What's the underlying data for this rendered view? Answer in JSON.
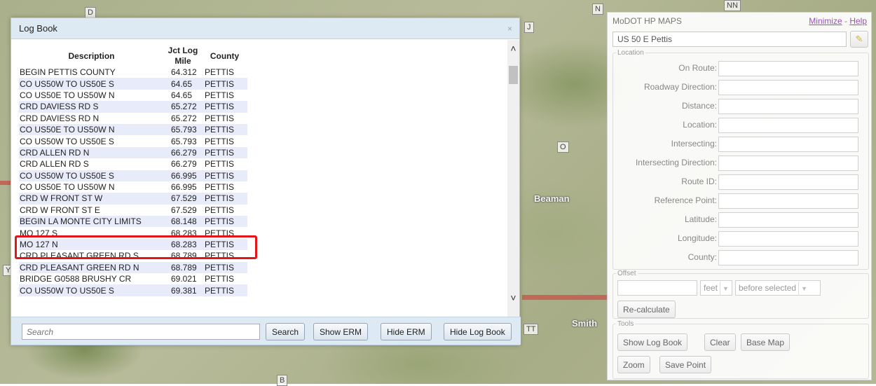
{
  "map": {
    "labels": {
      "d": "D",
      "n": "N",
      "nn": "NN",
      "j": "J",
      "o": "O",
      "b": "B",
      "tt": "TT",
      "y": "Y"
    },
    "towns": {
      "beaman": "Beaman",
      "smith": "Smith"
    }
  },
  "logbook": {
    "title": "Log Book",
    "close_icon": "close-icon",
    "columns": {
      "description": "Description",
      "log_mile": "Jct Log Mile",
      "county": "County"
    },
    "rows": [
      {
        "description": "BEGIN PETTIS COUNTY",
        "log_mile": "64.312",
        "county": "PETTIS"
      },
      {
        "description": "CO US50W TO US50E S",
        "log_mile": "64.65",
        "county": "PETTIS"
      },
      {
        "description": "CO US50E TO US50W N",
        "log_mile": "64.65",
        "county": "PETTIS"
      },
      {
        "description": "CRD DAVIESS RD S",
        "log_mile": "65.272",
        "county": "PETTIS"
      },
      {
        "description": "CRD DAVIESS RD N",
        "log_mile": "65.272",
        "county": "PETTIS"
      },
      {
        "description": "CO US50E TO US50W N",
        "log_mile": "65.793",
        "county": "PETTIS"
      },
      {
        "description": "CO US50W TO US50E S",
        "log_mile": "65.793",
        "county": "PETTIS"
      },
      {
        "description": "CRD ALLEN RD N",
        "log_mile": "66.279",
        "county": "PETTIS"
      },
      {
        "description": "CRD ALLEN RD S",
        "log_mile": "66.279",
        "county": "PETTIS"
      },
      {
        "description": "CO US50W TO US50E S",
        "log_mile": "66.995",
        "county": "PETTIS"
      },
      {
        "description": "CO US50E TO US50W N",
        "log_mile": "66.995",
        "county": "PETTIS"
      },
      {
        "description": "CRD W FRONT ST W",
        "log_mile": "67.529",
        "county": "PETTIS"
      },
      {
        "description": "CRD W FRONT ST E",
        "log_mile": "67.529",
        "county": "PETTIS"
      },
      {
        "description": "BEGIN LA MONTE CITY LIMITS",
        "log_mile": "68.148",
        "county": "PETTIS"
      },
      {
        "description": "MO 127 S",
        "log_mile": "68.283",
        "county": "PETTIS"
      },
      {
        "description": "MO 127 N",
        "log_mile": "68.283",
        "county": "PETTIS"
      },
      {
        "description": "CRD PLEASANT GREEN RD S",
        "log_mile": "68.789",
        "county": "PETTIS"
      },
      {
        "description": "CRD PLEASANT GREEN RD N",
        "log_mile": "68.789",
        "county": "PETTIS"
      },
      {
        "description": "BRIDGE G0588 BRUSHY CR",
        "log_mile": "69.021",
        "county": "PETTIS"
      },
      {
        "description": "CO US50W TO US50E S",
        "log_mile": "69.381",
        "county": "PETTIS"
      }
    ],
    "search": {
      "placeholder": "Search",
      "value": ""
    },
    "buttons": {
      "search": "Search",
      "show_erm": "Show ERM",
      "hide_erm": "Hide ERM",
      "hide_log_book": "Hide Log Book"
    },
    "scroll": {
      "up": "^",
      "down": "v"
    }
  },
  "panel": {
    "title": "MoDOT HP MAPS",
    "minimize": "Minimize",
    "separator": "-",
    "help": "Help",
    "route_value": "US 50 E Pettis",
    "route_button_icon": "pen-icon",
    "location": {
      "legend": "Location",
      "fields": [
        {
          "label": "On Route:",
          "value": ""
        },
        {
          "label": "Roadway Direction:",
          "value": ""
        },
        {
          "label": "Distance:",
          "value": ""
        },
        {
          "label": "Location:",
          "value": ""
        },
        {
          "label": "Intersecting:",
          "value": ""
        },
        {
          "label": "Intersecting Direction:",
          "value": ""
        },
        {
          "label": "Route ID:",
          "value": ""
        },
        {
          "label": "Reference Point:",
          "value": ""
        },
        {
          "label": "Latitude:",
          "value": ""
        },
        {
          "label": "Longitude:",
          "value": ""
        },
        {
          "label": "County:",
          "value": ""
        }
      ]
    },
    "offset": {
      "legend": "Offset",
      "value": "",
      "unit": "feet",
      "direction": "before selected",
      "recalculate": "Re-calculate"
    },
    "tools": {
      "legend": "Tools",
      "show_log_book": "Show Log Book",
      "clear": "Clear",
      "base_map": "Base Map",
      "zoom": "Zoom",
      "save_point": "Save Point"
    }
  },
  "colors": {
    "highlight": "#e3141a",
    "header_bg": "#dde9f3",
    "alt_row": "#e8ebfa",
    "link": "#9a4fb5"
  }
}
